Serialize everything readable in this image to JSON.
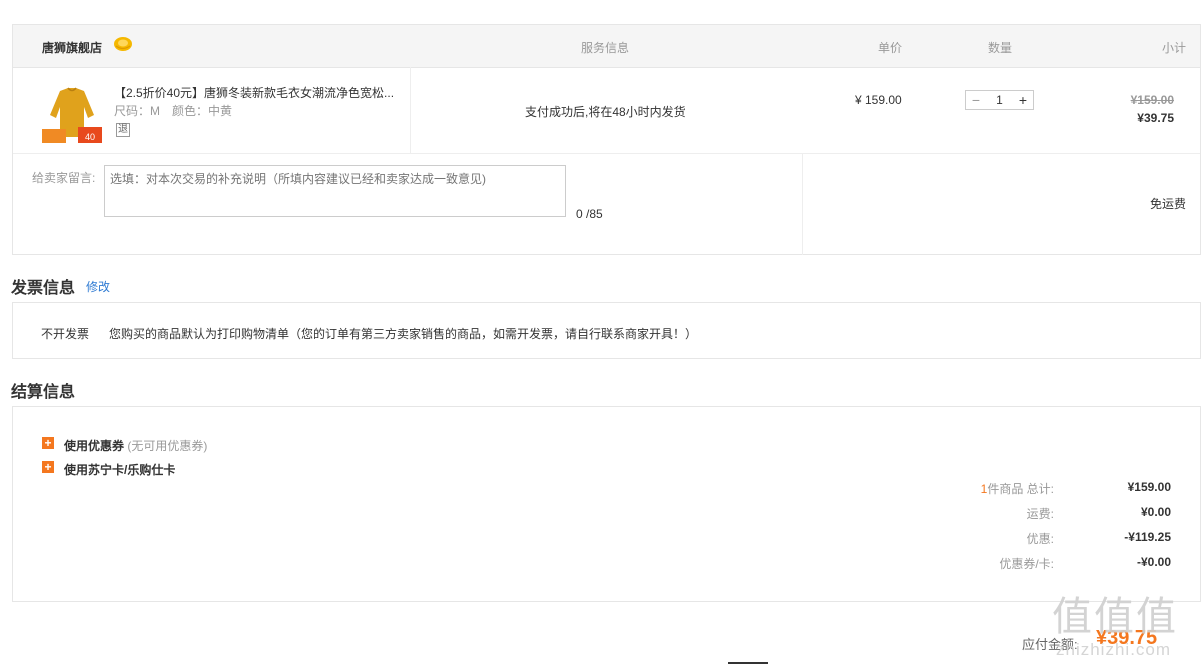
{
  "order": {
    "store_name": "唐狮旗舰店",
    "headers": {
      "service": "服务信息",
      "unit_price": "单价",
      "quantity": "数量",
      "subtotal": "小计"
    },
    "item": {
      "title": "【2.5折价40元】唐狮冬装新款毛衣女潮流净色宽松...",
      "spec": "尺码：M　颜色：中黄",
      "return_badge": "退",
      "thumb_tag": "40",
      "service_text": "支付成功后,将在48小时内发货",
      "unit_price": "¥ 159.00",
      "quantity": "1",
      "qty_minus": "−",
      "qty_plus": "+",
      "original_subtotal": "¥159.00",
      "final_subtotal": "¥39.75"
    },
    "message": {
      "label": "给卖家留言:",
      "placeholder": "选填：对本次交易的补充说明（所填内容建议已经和卖家达成一致意见)",
      "count": "0 /85"
    },
    "shipping": "免运费"
  },
  "invoice": {
    "title": "发票信息",
    "modify": "修改",
    "type": "不开发票",
    "description": "您购买的商品默认为打印购物清单（您的订单有第三方卖家销售的商品，如需开发票，请自行联系商家开具！）"
  },
  "settlement": {
    "title": "结算信息",
    "options": [
      {
        "label": "使用优惠券",
        "note": "(无可用优惠券)"
      },
      {
        "label": "使用苏宁卡/乐购仕卡",
        "note": ""
      }
    ],
    "summary": {
      "items_count": "1",
      "items_label": "件商品 总计:",
      "items_total": "¥159.00",
      "shipping_label": "运费:",
      "shipping_value": "¥0.00",
      "discount_label": "优惠:",
      "discount_value": "-¥119.25",
      "coupon_label": "优惠券/卡:",
      "coupon_value": "-¥0.00"
    },
    "payable_label": "应付金额:",
    "payable_value": "¥39.75"
  },
  "watermark": {
    "main": "值值值",
    "sub": "zhizhizhi.com"
  },
  "colors": {
    "accent": "#f4771f",
    "link": "#2f7bd3",
    "border": "#e6e6e6",
    "muted": "#999999"
  }
}
